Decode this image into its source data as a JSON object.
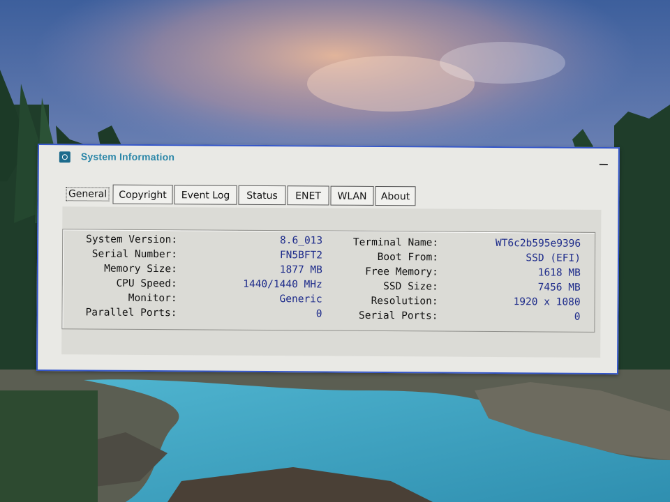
{
  "window": {
    "title": "System Information",
    "minimize_icon": "minimize-icon"
  },
  "tabs": [
    {
      "label": "General",
      "active": true
    },
    {
      "label": "Copyright",
      "active": false
    },
    {
      "label": "Event Log",
      "active": false
    },
    {
      "label": "Status",
      "active": false
    },
    {
      "label": "ENET",
      "active": false
    },
    {
      "label": "WLAN",
      "active": false
    },
    {
      "label": "About",
      "active": false
    }
  ],
  "info_left": [
    {
      "label": "System Version:",
      "value": "8.6_013"
    },
    {
      "label": "Serial Number:",
      "value": "FN5BFT2"
    },
    {
      "label": "Memory Size:",
      "value": "1877 MB"
    },
    {
      "label": "CPU Speed:",
      "value": "1440/1440 MHz"
    },
    {
      "label": "Monitor:",
      "value": "Generic"
    },
    {
      "label": "Parallel Ports:",
      "value": "0"
    }
  ],
  "info_right": [
    {
      "label": "Terminal Name:",
      "value": "WT6c2b595e9396"
    },
    {
      "label": "Boot From:",
      "value": "SSD (EFI)"
    },
    {
      "label": "Free Memory:",
      "value": "1618 MB"
    },
    {
      "label": "SSD Size:",
      "value": "7456 MB"
    },
    {
      "label": "Resolution:",
      "value": "1920 x 1080"
    },
    {
      "label": "Serial Ports:",
      "value": "0"
    }
  ],
  "colors": {
    "title_text": "#2a86a8",
    "value_text": "#1c2a8a",
    "window_border": "#3355c8",
    "window_bg": "#e9e9e5",
    "panel_bg": "#dbdbd6"
  }
}
